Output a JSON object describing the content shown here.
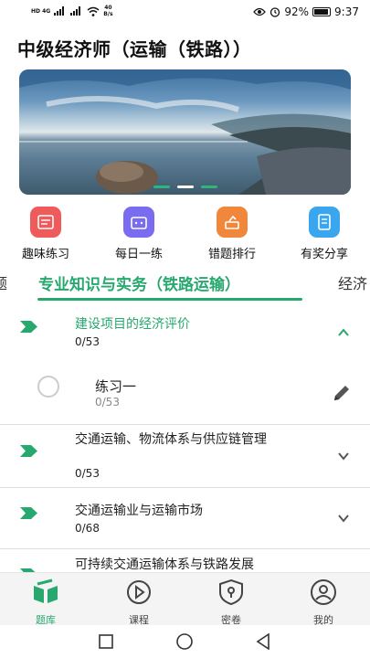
{
  "status_bar": {
    "network_left": "HD 4G",
    "speed": "40",
    "speed_unit": "B/s",
    "battery": "92%",
    "time": "9:37"
  },
  "header": {
    "title": "中级经济师（运输（铁路））"
  },
  "banner": {
    "slides": 3,
    "active_slide": 2
  },
  "quick_menu": [
    {
      "label": "趣味练习",
      "icon": "quiz-icon",
      "color": "#ef5b5b"
    },
    {
      "label": "每日一练",
      "icon": "bag-icon",
      "color": "#7a6cf0"
    },
    {
      "label": "错题排行",
      "icon": "ranking-icon",
      "color": "#f0873a"
    },
    {
      "label": "有奖分享",
      "icon": "notebook-icon",
      "color": "#3aa6f0"
    }
  ],
  "tabs": {
    "left_partial": "题",
    "active": "专业知识与实务（铁路运输）",
    "right_partial": "经济"
  },
  "sections": [
    {
      "title": "建设项目的经济评价",
      "count": "0/53",
      "expanded": true
    },
    {
      "title": "交通运输、物流体系与供应链管理",
      "count": "0/53",
      "expanded": false
    },
    {
      "title": "交通运输业与运输市场",
      "count": "0/68",
      "expanded": false
    },
    {
      "title": "可持续交通运输体系与铁路发展",
      "count": "",
      "expanded": false
    }
  ],
  "sub_item": {
    "title": "练习一",
    "count": "0/53"
  },
  "bottom_nav": [
    {
      "label": "题库",
      "icon": "books-icon",
      "active": true
    },
    {
      "label": "课程",
      "icon": "play-icon",
      "active": false
    },
    {
      "label": "密卷",
      "icon": "lock-shield-icon",
      "active": false
    },
    {
      "label": "我的",
      "icon": "profile-icon",
      "active": false
    }
  ],
  "colors": {
    "accent": "#27a86e",
    "divider": "#dddddd"
  }
}
